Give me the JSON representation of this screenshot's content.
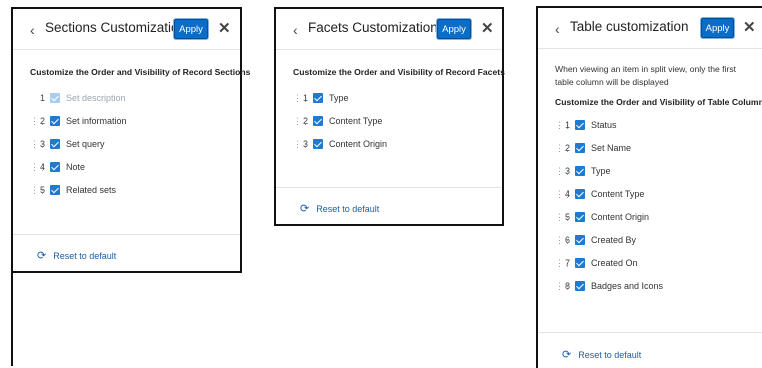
{
  "panels": [
    {
      "back": "‹",
      "title": "Sections Customization",
      "apply_label": "Apply",
      "close": "✕",
      "subtitle": "Customize the Order and Visibility of Record Sections",
      "items": [
        {
          "num": "1",
          "label": "Set description",
          "disabled": true
        },
        {
          "num": "2",
          "label": "Set information"
        },
        {
          "num": "3",
          "label": "Set query"
        },
        {
          "num": "4",
          "label": "Note"
        },
        {
          "num": "5",
          "label": "Related sets"
        }
      ],
      "reset_label": "Reset to default"
    },
    {
      "back": "‹",
      "title": "Facets Customization",
      "apply_label": "Apply",
      "close": "✕",
      "subtitle": "Customize the Order and Visibility of Record Facets",
      "items": [
        {
          "num": "1",
          "label": "Type"
        },
        {
          "num": "2",
          "label": "Content Type"
        },
        {
          "num": "3",
          "label": "Content Origin"
        }
      ],
      "reset_label": "Reset to default"
    },
    {
      "back": "‹",
      "title": "Table customization",
      "apply_label": "Apply",
      "close": "✕",
      "description": "When viewing an item in split view, only the first table column will be displayed",
      "subtitle": "Customize the Order and Visibility of Table Columns",
      "items": [
        {
          "num": "1",
          "label": "Status"
        },
        {
          "num": "2",
          "label": "Set Name"
        },
        {
          "num": "3",
          "label": "Type"
        },
        {
          "num": "4",
          "label": "Content Type"
        },
        {
          "num": "5",
          "label": "Content Origin"
        },
        {
          "num": "6",
          "label": "Created By"
        },
        {
          "num": "7",
          "label": "Created On"
        },
        {
          "num": "8",
          "label": "Badges and Icons"
        }
      ],
      "reset_label": "Reset to default"
    }
  ],
  "icons": {
    "drag": "drag-handle-icon",
    "reset": "refresh-icon",
    "check": "checkbox-checked-icon"
  },
  "colors": {
    "accent": "#0a6dc7",
    "checkbox": "#1f7ad1",
    "link": "#1a5fa8"
  }
}
